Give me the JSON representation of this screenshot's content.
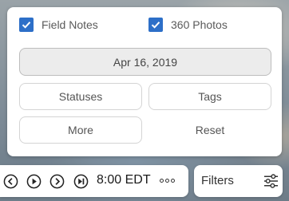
{
  "layers": {
    "field_notes": {
      "label": "Field Notes",
      "checked": true
    },
    "photos_360": {
      "label": "360 Photos",
      "checked": true
    }
  },
  "date_button": {
    "label": "Apr 16, 2019"
  },
  "filter_buttons": {
    "statuses": "Statuses",
    "tags": "Tags",
    "more": "More",
    "reset": "Reset"
  },
  "playback": {
    "time": "8:00 EDT",
    "controls": [
      "rewind-icon",
      "play-icon",
      "forward-icon",
      "skip-next-icon",
      "more-options-icon"
    ]
  },
  "filters_button": {
    "label": "Filters",
    "icon": "sliders-icon"
  },
  "colors": {
    "checkbox": "#2d6fc8",
    "panel_bg": "#ffffff"
  }
}
